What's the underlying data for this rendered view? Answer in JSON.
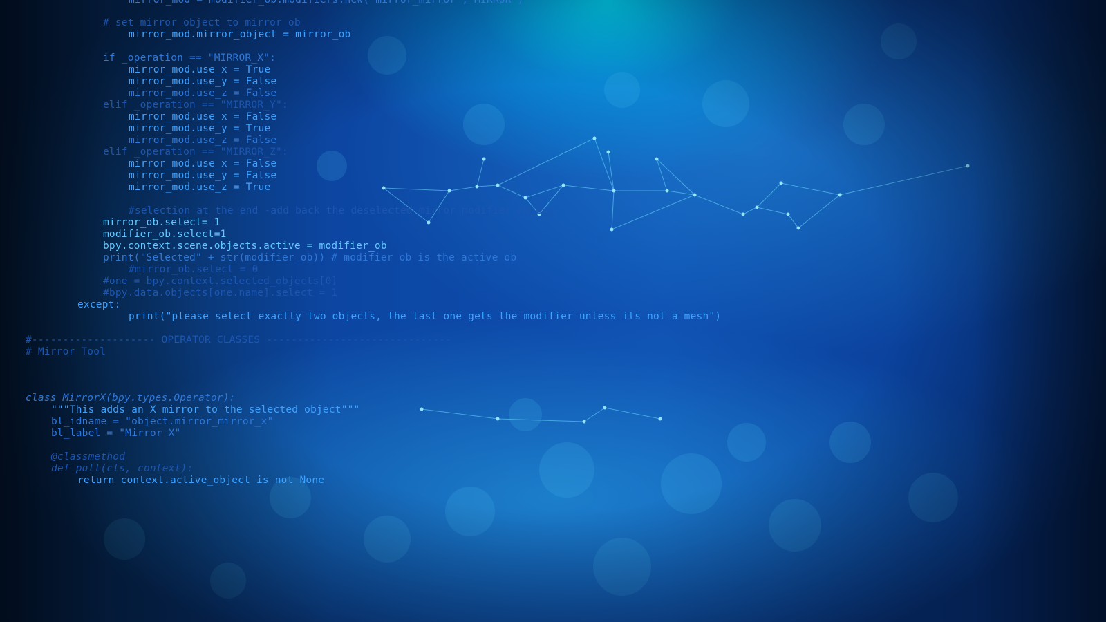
{
  "scene": {
    "description": "Blurred blue abstract network background with overlaid Python source code",
    "colors": {
      "primary": "#0e4db0",
      "highlight": "#00e6ff",
      "code": "#3fa2ff"
    }
  },
  "code_lines": [
    {
      "text": "mirror_mod = modifier_ob.modifiers.new(\"mirror_mirror\", MIRROR\")",
      "tone": "c2"
    },
    {
      "text": "# set mirror object to mirror_ob",
      "tone": "c3"
    },
    {
      "text": "mirror_mod.mirror_object = mirror_ob",
      "tone": "c1"
    },
    {
      "text": "if _operation == \"MIRROR_X\":",
      "tone": "c2"
    },
    {
      "text": "mirror_mod.use_x = True",
      "tone": "c1"
    },
    {
      "text": "mirror_mod.use_y = False",
      "tone": "c1"
    },
    {
      "text": "mirror_mod.use_z = False",
      "tone": "c2"
    },
    {
      "text": "elif _operation == \"MIRROR_Y\":",
      "tone": "c3"
    },
    {
      "text": "mirror_mod.use_x = False",
      "tone": "c1"
    },
    {
      "text": "mirror_mod.use_y = True",
      "tone": "c1"
    },
    {
      "text": "mirror_mod.use_z = False",
      "tone": "c2"
    },
    {
      "text": "elif _operation == \"MIRROR_Z\":",
      "tone": "c3"
    },
    {
      "text": "mirror_mod.use_x = False",
      "tone": "c1"
    },
    {
      "text": "mirror_mod.use_y = False",
      "tone": "c1"
    },
    {
      "text": "mirror_mod.use_z = True",
      "tone": "c1"
    },
    {
      "text": "#selection at the end -add back the deselected mirror modifier object",
      "tone": "c3"
    },
    {
      "text": "mirror_ob.select= 1",
      "tone": "c4"
    },
    {
      "text": "modifier_ob.select=1",
      "tone": "c4"
    },
    {
      "text": "bpy.context.scene.objects.active = modifier_ob",
      "tone": "c4"
    },
    {
      "text": "print(\"Selected\" + str(modifier_ob)) # modifier ob is the active ob",
      "tone": "c2"
    },
    {
      "text": "#mirror_ob.select = 0",
      "tone": "c3"
    },
    {
      "text": "#one = bpy.context.selected_objects[0]",
      "tone": "c3"
    },
    {
      "text": "#bpy.data.objects[one.name].select = 1",
      "tone": "c3"
    },
    {
      "text": "except:",
      "tone": "c1"
    },
    {
      "text": "print(\"please select exactly two objects, the last one gets the modifier unless its not a mesh\")",
      "tone": "c1"
    },
    {
      "text": "#-------------------- OPERATOR CLASSES ------------------------------",
      "tone": "c3"
    },
    {
      "text": "# Mirror Tool",
      "tone": "c3"
    },
    {
      "text": "class MirrorX(bpy.types.Operator):",
      "tone": "c2"
    },
    {
      "text": "\"\"\"This adds an X mirror to the selected object\"\"\"",
      "tone": "c1"
    },
    {
      "text": "bl_idname = \"object.mirror_mirror_x\"",
      "tone": "c2"
    },
    {
      "text": "bl_label = \"Mirror X\"",
      "tone": "c2"
    },
    {
      "text": "@classmethod",
      "tone": "c3"
    },
    {
      "text": "def poll(cls, context):",
      "tone": "c3"
    },
    {
      "text": "return context.active_object is not None",
      "tone": "c1"
    }
  ]
}
